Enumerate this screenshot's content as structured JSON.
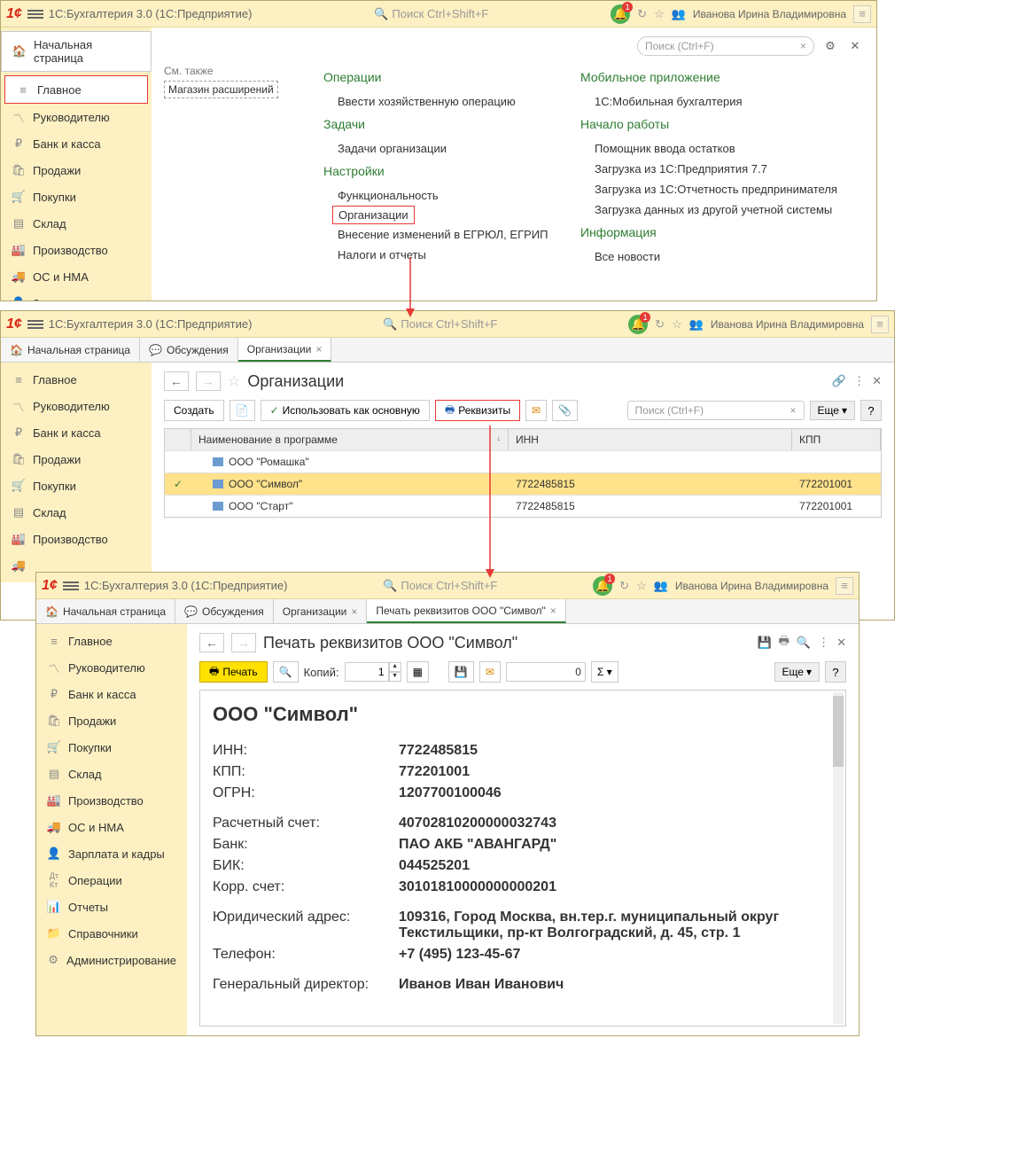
{
  "app": {
    "title": "1С:Бухгалтерия 3.0  (1С:Предприятие)",
    "search_placeholder": "Поиск Ctrl+Shift+F",
    "bell_badge": "1",
    "user": "Иванова Ирина Владимировна"
  },
  "tabs1": {
    "home": "Начальная страница"
  },
  "sidebar1": {
    "items": [
      {
        "icon": "🏠",
        "label": "Начальная страница"
      },
      {
        "icon": "≡",
        "label": "Главное",
        "hl": true
      },
      {
        "icon": "📈",
        "label": "Руководителю"
      },
      {
        "icon": "₽",
        "label": "Банк и касса"
      },
      {
        "icon": "🛍",
        "label": "Продажи"
      },
      {
        "icon": "🛒",
        "label": "Покупки"
      },
      {
        "icon": "☰",
        "label": "Склад"
      },
      {
        "icon": "🏭",
        "label": "Производство"
      },
      {
        "icon": "🚚",
        "label": "ОС и НМА"
      },
      {
        "icon": "👤",
        "label": "Зарплата и кадры"
      }
    ]
  },
  "screen1": {
    "search_ph": "Поиск (Ctrl+F)",
    "see_also": "См. также",
    "ext_store": "Магазин расширений",
    "col1": {
      "h1": "Операции",
      "l1": "Ввести хозяйственную операцию",
      "h2": "Задачи",
      "l2": "Задачи организации",
      "h3": "Настройки",
      "l3": "Функциональность",
      "l4": "Организации",
      "l5": "Внесение изменений в ЕГРЮЛ, ЕГРИП",
      "l6": "Налоги и отчеты"
    },
    "col2": {
      "h1": "Мобильное приложение",
      "l1": "1С:Мобильная бухгалтерия",
      "h2": "Начало работы",
      "l2": "Помощник ввода остатков",
      "l3": "Загрузка из 1С:Предприятия 7.7",
      "l4": "Загрузка из 1С:Отчетность предпринимателя",
      "l5": "Загрузка данных из другой учетной системы",
      "h3": "Информация",
      "l6": "Все новости"
    }
  },
  "tabs2": {
    "home": "Начальная страница",
    "discuss": "Обсуждения",
    "org": "Организации"
  },
  "sidebar2": {
    "items": [
      {
        "icon": "≡",
        "label": "Главное"
      },
      {
        "icon": "📈",
        "label": "Руководителю"
      },
      {
        "icon": "₽",
        "label": "Банк и касса"
      },
      {
        "icon": "🛍",
        "label": "Продажи"
      },
      {
        "icon": "🛒",
        "label": "Покупки"
      },
      {
        "icon": "☰",
        "label": "Склад"
      },
      {
        "icon": "🏭",
        "label": "Производство"
      },
      {
        "icon": "🚚",
        "label": ""
      }
    ]
  },
  "screen2": {
    "title": "Организации",
    "create": "Создать",
    "use_main": "Использовать как основную",
    "rekv": "Реквизиты",
    "more": "Еще",
    "search_ph": "Поиск (Ctrl+F)",
    "th_name": "Наименование в программе",
    "th_inn": "ИНН",
    "th_kpp": "КПП",
    "rows": [
      {
        "chk": "",
        "name": "ООО \"Ромашка\"",
        "inn": "",
        "kpp": ""
      },
      {
        "chk": "✓",
        "name": "ООО \"Символ\"",
        "inn": "7722485815",
        "kpp": "772201001",
        "sel": true
      },
      {
        "chk": "",
        "name": "ООО \"Старт\"",
        "inn": "7722485815",
        "kpp": "772201001"
      }
    ]
  },
  "tabs3": {
    "home": "Начальная страница",
    "discuss": "Обсуждения",
    "org": "Организации",
    "print": "Печать реквизитов ООО \"Символ\""
  },
  "sidebar3": {
    "items": [
      {
        "icon": "≡",
        "label": "Главное"
      },
      {
        "icon": "📈",
        "label": "Руководителю"
      },
      {
        "icon": "₽",
        "label": "Банк и касса"
      },
      {
        "icon": "🛍",
        "label": "Продажи"
      },
      {
        "icon": "🛒",
        "label": "Покупки"
      },
      {
        "icon": "☰",
        "label": "Склад"
      },
      {
        "icon": "🏭",
        "label": "Производство"
      },
      {
        "icon": "🚚",
        "label": "ОС и НМА"
      },
      {
        "icon": "👤",
        "label": "Зарплата и кадры"
      },
      {
        "icon": "Дт",
        "label": "Операции"
      },
      {
        "icon": "📊",
        "label": "Отчеты"
      },
      {
        "icon": "📁",
        "label": "Справочники"
      },
      {
        "icon": "⚙",
        "label": "Администрирование"
      }
    ]
  },
  "screen3": {
    "title": "Печать реквизитов ООО \"Символ\"",
    "print_btn": "Печать",
    "copies": "Копий:",
    "copies_val": "1",
    "sum_val": "0",
    "more": "Еще",
    "doc": {
      "org": "ООО \"Символ\"",
      "rows": [
        {
          "lbl": "ИНН:",
          "val": "7722485815"
        },
        {
          "lbl": "КПП:",
          "val": "772201001"
        },
        {
          "lbl": "ОГРН:",
          "val": "1207700100046"
        }
      ],
      "rows2": [
        {
          "lbl": "Расчетный счет:",
          "val": "40702810200000032743"
        },
        {
          "lbl": "Банк:",
          "val": "ПАО АКБ \"АВАНГАРД\""
        },
        {
          "lbl": "БИК:",
          "val": "044525201"
        },
        {
          "lbl": "Корр. счет:",
          "val": "30101810000000000201"
        }
      ],
      "rows3": [
        {
          "lbl": "Юридический адрес:",
          "val": "109316, Город Москва, вн.тер.г. муниципальный округ Текстильщики, пр-кт Волгоградский, д. 45, стр. 1"
        },
        {
          "lbl": "Телефон:",
          "val": "+7 (495) 123-45-67"
        }
      ],
      "rows4": [
        {
          "lbl": "Генеральный директор:",
          "val": "Иванов Иван Иванович"
        }
      ]
    }
  }
}
